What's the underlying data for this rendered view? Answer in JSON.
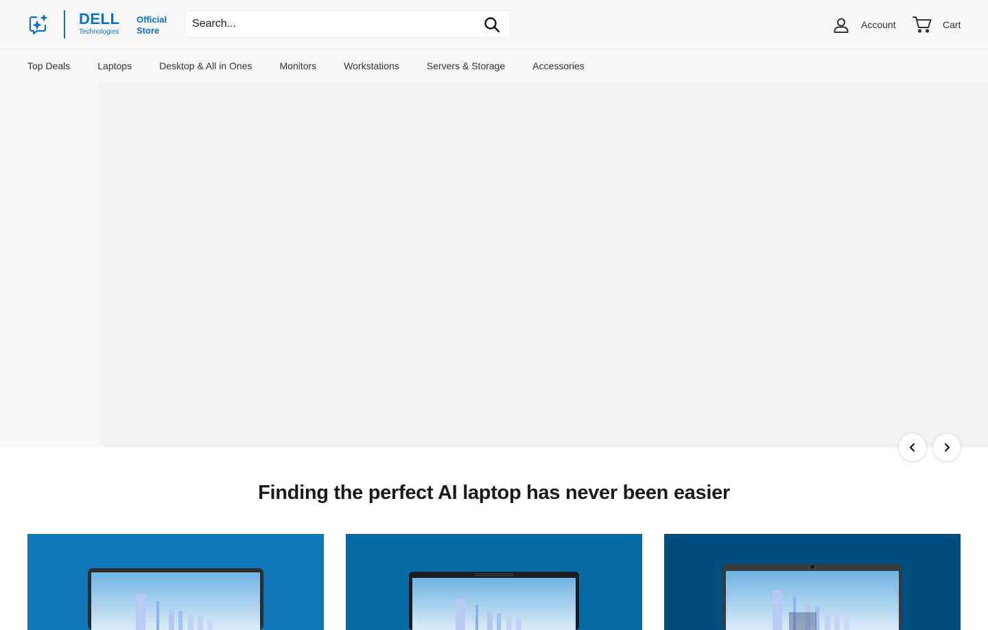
{
  "header": {
    "brand_name": "DELL",
    "brand_sub": "Technologies",
    "store_line1": "Official",
    "store_line2": "Store",
    "search_placeholder": "Search...",
    "account_label": "Account",
    "cart_label": "Cart"
  },
  "nav": {
    "items": [
      {
        "label": "Top Deals"
      },
      {
        "label": "Laptops"
      },
      {
        "label": "Desktop & All in Ones"
      },
      {
        "label": "Monitors"
      },
      {
        "label": "Workstations"
      },
      {
        "label": "Servers & Storage"
      },
      {
        "label": "Accessories"
      }
    ]
  },
  "main": {
    "section_title": "Finding the perfect AI laptop has never been easier"
  },
  "colors": {
    "brand_blue": "#0672cb",
    "card1_bg": "#0f76b8",
    "card2_bg": "#076aa5",
    "card3_bg": "#004e7d"
  },
  "icons": {
    "ai": "sparkle-ai-icon",
    "search": "search-icon",
    "account": "user-icon",
    "cart": "cart-icon",
    "prev": "chevron-left-icon",
    "next": "chevron-right-icon"
  }
}
